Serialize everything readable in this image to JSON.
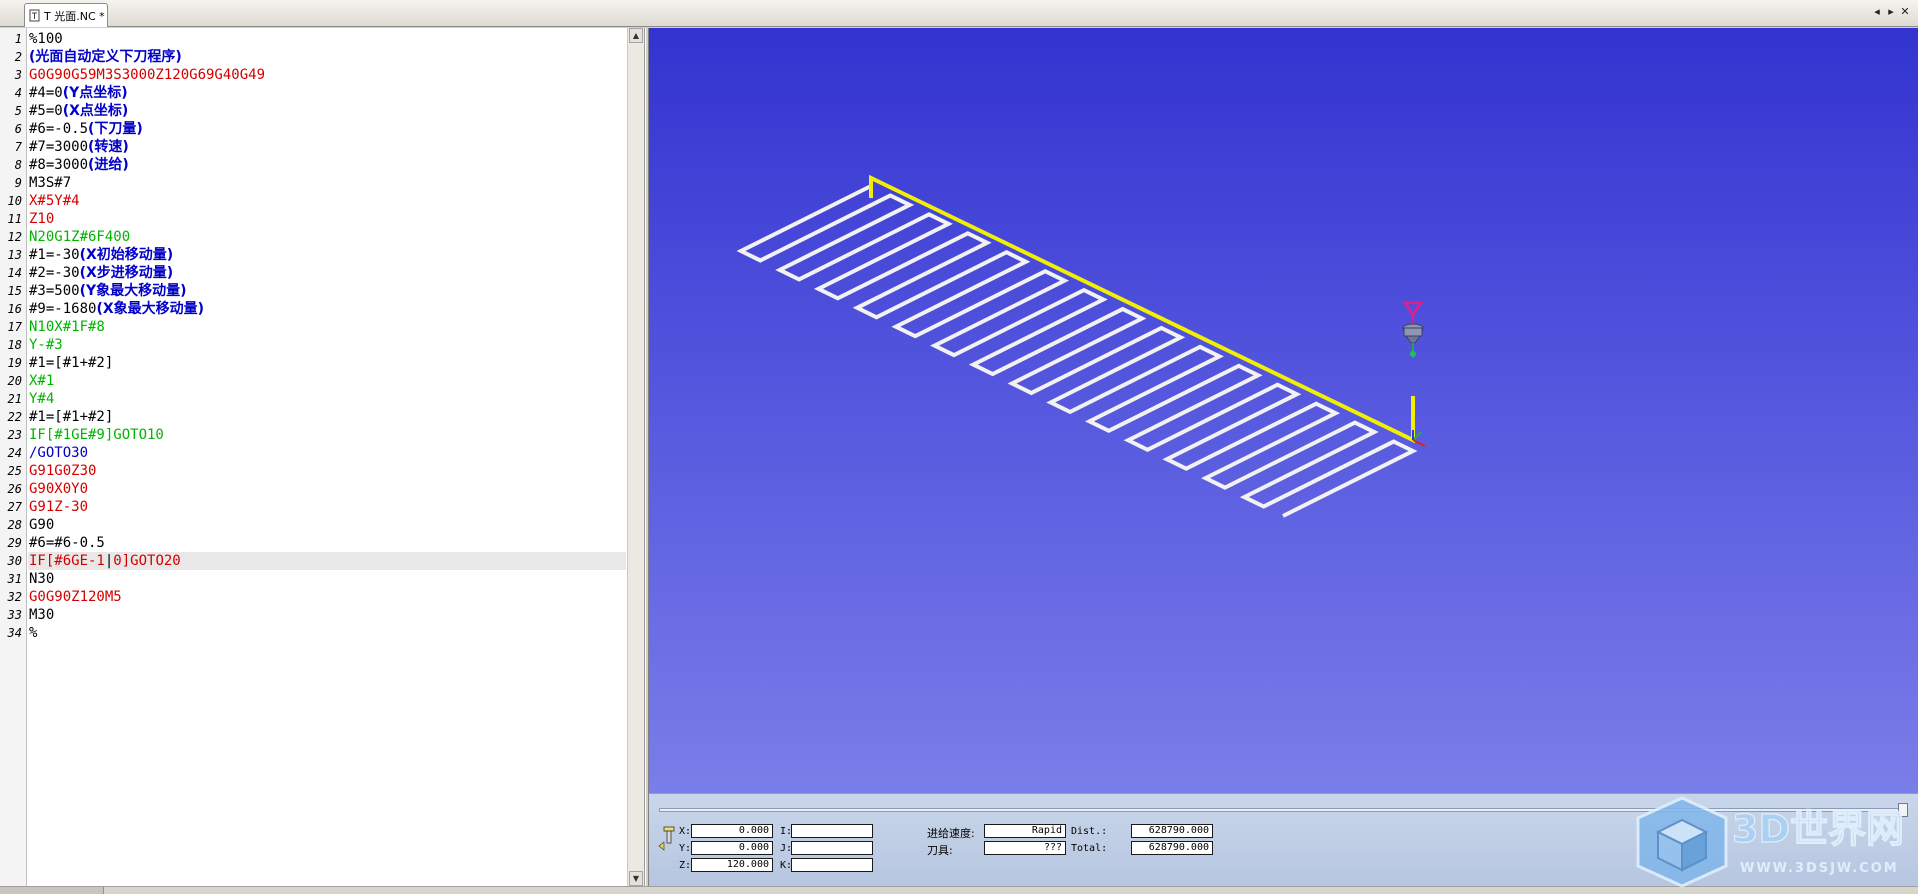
{
  "tab": {
    "label": "T 光面.NC *",
    "nav_left": "◂",
    "nav_right": "▸",
    "nav_close": "✕"
  },
  "editor": {
    "lines": [
      {
        "n": "1",
        "segs": [
          {
            "t": "%100",
            "c": "black"
          }
        ]
      },
      {
        "n": "2",
        "segs": [
          {
            "t": "(光面自动定义下刀程序)",
            "c": "cmt"
          }
        ]
      },
      {
        "n": "3",
        "segs": [
          {
            "t": "G0G90G59M3S3000Z120G69G40G49",
            "c": "red"
          }
        ]
      },
      {
        "n": "4",
        "segs": [
          {
            "t": "#4=0",
            "c": "black"
          },
          {
            "t": "(Y点坐标)",
            "c": "cmt"
          }
        ]
      },
      {
        "n": "5",
        "segs": [
          {
            "t": "#5=0",
            "c": "black"
          },
          {
            "t": "(X点坐标)",
            "c": "cmt"
          }
        ]
      },
      {
        "n": "6",
        "segs": [
          {
            "t": "#6=-0.5",
            "c": "black"
          },
          {
            "t": "(下刀量)",
            "c": "cmt"
          }
        ]
      },
      {
        "n": "7",
        "segs": [
          {
            "t": "#7=3000",
            "c": "black"
          },
          {
            "t": "(转速)",
            "c": "cmt"
          }
        ]
      },
      {
        "n": "8",
        "segs": [
          {
            "t": "#8=3000",
            "c": "black"
          },
          {
            "t": "(进给)",
            "c": "cmt"
          }
        ]
      },
      {
        "n": "9",
        "segs": [
          {
            "t": "M3S#7",
            "c": "black"
          }
        ]
      },
      {
        "n": "10",
        "segs": [
          {
            "t": "X#5Y#4",
            "c": "red"
          }
        ]
      },
      {
        "n": "11",
        "segs": [
          {
            "t": "Z10",
            "c": "red"
          }
        ]
      },
      {
        "n": "12",
        "segs": [
          {
            "t": "N20G1Z#6F400",
            "c": "green"
          }
        ]
      },
      {
        "n": "13",
        "segs": [
          {
            "t": "#1=-30",
            "c": "black"
          },
          {
            "t": "(X初始移动量)",
            "c": "cmt"
          }
        ]
      },
      {
        "n": "14",
        "segs": [
          {
            "t": "#2=-30",
            "c": "black"
          },
          {
            "t": "(X步进移动量)",
            "c": "cmt"
          }
        ]
      },
      {
        "n": "15",
        "segs": [
          {
            "t": "#3=500",
            "c": "black"
          },
          {
            "t": "(Y象最大移动量)",
            "c": "cmt"
          }
        ]
      },
      {
        "n": "16",
        "segs": [
          {
            "t": "#9=-1680",
            "c": "black"
          },
          {
            "t": "(X象最大移动量)",
            "c": "cmt"
          }
        ]
      },
      {
        "n": "17",
        "segs": [
          {
            "t": "N10X#1F#8",
            "c": "green"
          }
        ]
      },
      {
        "n": "18",
        "segs": [
          {
            "t": "Y-#3",
            "c": "green"
          }
        ]
      },
      {
        "n": "19",
        "segs": [
          {
            "t": "#1=[#1+#2]",
            "c": "black"
          }
        ]
      },
      {
        "n": "20",
        "segs": [
          {
            "t": "X#1",
            "c": "green"
          }
        ]
      },
      {
        "n": "21",
        "segs": [
          {
            "t": "Y#4",
            "c": "green"
          }
        ]
      },
      {
        "n": "22",
        "segs": [
          {
            "t": "#1=[#1+#2]",
            "c": "black"
          }
        ]
      },
      {
        "n": "23",
        "segs": [
          {
            "t": "IF[#1GE#9]GOTO10",
            "c": "green"
          }
        ]
      },
      {
        "n": "24",
        "segs": [
          {
            "t": "/GOTO30",
            "c": "blue"
          }
        ]
      },
      {
        "n": "25",
        "segs": [
          {
            "t": "G91G0Z30",
            "c": "red"
          }
        ]
      },
      {
        "n": "26",
        "segs": [
          {
            "t": "G90X0Y0",
            "c": "red"
          }
        ]
      },
      {
        "n": "27",
        "segs": [
          {
            "t": "G91Z-30",
            "c": "red"
          }
        ]
      },
      {
        "n": "28",
        "segs": [
          {
            "t": "G90",
            "c": "black"
          }
        ]
      },
      {
        "n": "29",
        "segs": [
          {
            "t": "#6=#6-0.5",
            "c": "black"
          }
        ]
      },
      {
        "n": "30",
        "segs": [
          {
            "t": "IF[#6GE-1",
            "c": "red"
          },
          {
            "t": "|",
            "c": "black"
          },
          {
            "t": "0]",
            "c": "red"
          },
          {
            "t": "GOTO20",
            "c": "red"
          }
        ],
        "active": true
      },
      {
        "n": "31",
        "segs": [
          {
            "t": "N30",
            "c": "black"
          }
        ]
      },
      {
        "n": "32",
        "segs": [
          {
            "t": "G0G90Z120M5",
            "c": "red"
          }
        ]
      },
      {
        "n": "33",
        "segs": [
          {
            "t": "M30",
            "c": "black"
          }
        ]
      },
      {
        "n": "34",
        "segs": [
          {
            "t": "%",
            "c": "black"
          }
        ]
      }
    ],
    "scroll_up": "▲",
    "scroll_down": "▼"
  },
  "colors": {
    "toolpath_feed": "#f2f2f2",
    "toolpath_rapid": "#f0f000",
    "tool_marker": "#e0208a",
    "tool_body": "#8e96b4"
  },
  "status": {
    "x_label": "X:",
    "x_value": "0.000",
    "y_label": "Y:",
    "y_value": "0.000",
    "z_label": "Z:",
    "z_value": "120.000",
    "i_label": "I:",
    "i_value": "",
    "j_label": "J:",
    "j_value": "",
    "k_label": "K:",
    "k_value": "",
    "feed_label": "进给速度:",
    "feed_value": "Rapid",
    "tool_label": "刀具:",
    "tool_value": "???",
    "dist_label": "Dist.:",
    "dist_value": "628790.000",
    "total_label": "Total:",
    "total_value": "628790.000",
    "progress_fraction": 1.0
  },
  "watermark": {
    "brand": "3D世界网",
    "url": "WWW.3DSJW.COM"
  }
}
